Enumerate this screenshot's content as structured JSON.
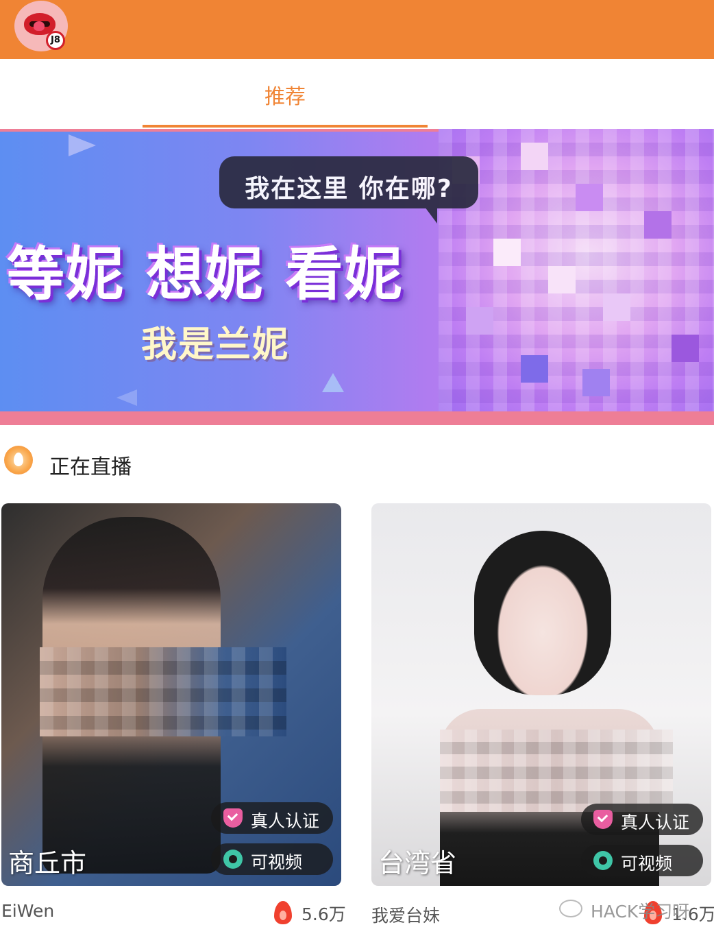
{
  "app": {
    "logo": {
      "badge_text": "J8"
    }
  },
  "tabs": [
    {
      "label": "推荐",
      "active": true
    }
  ],
  "banner": {
    "bubble_text": "我在这里  你在哪?",
    "headline": "等妮 想妮 看妮",
    "subline": "我是兰妮"
  },
  "section": {
    "title": "正在直播",
    "icon": "fire-icon"
  },
  "cards": [
    {
      "city": "商丘市",
      "verified_label": "真人认证",
      "video_label": "可视频",
      "name": "EiWen",
      "popularity": "5.6万"
    },
    {
      "city": "台湾省",
      "verified_label": "真人认证",
      "video_label": "可视频",
      "name": "我爱台妹",
      "popularity": "1.6万"
    }
  ],
  "watermark": "HACK学习呀",
  "colors": {
    "accent": "#F08434",
    "verified": "#E95EA0",
    "video": "#3FC6A7",
    "flame": "#F0402E"
  }
}
